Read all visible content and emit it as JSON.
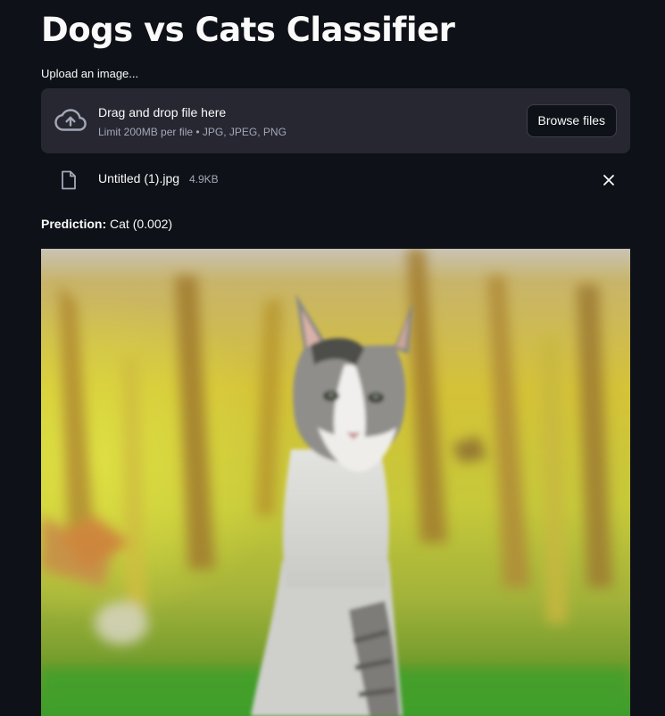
{
  "page": {
    "title": "Dogs vs Cats Classifier"
  },
  "uploader": {
    "label": "Upload an image...",
    "dropzone_title": "Drag and drop file here",
    "dropzone_subtitle": "Limit 200MB per file • JPG, JPEG, PNG",
    "browse_label": "Browse files",
    "icon": "cloud-upload-icon"
  },
  "uploaded_file": {
    "name": "Untitled (1).jpg",
    "size": "4.9KB",
    "icon": "file-icon",
    "remove_icon": "close-icon"
  },
  "prediction": {
    "label": "Prediction:",
    "value": "Cat (0.002)"
  },
  "image": {
    "subject": "cat"
  },
  "colors": {
    "background": "#0e1117",
    "dropzone": "#262730",
    "text": "#fafafa",
    "muted": "#a3a8b8"
  }
}
